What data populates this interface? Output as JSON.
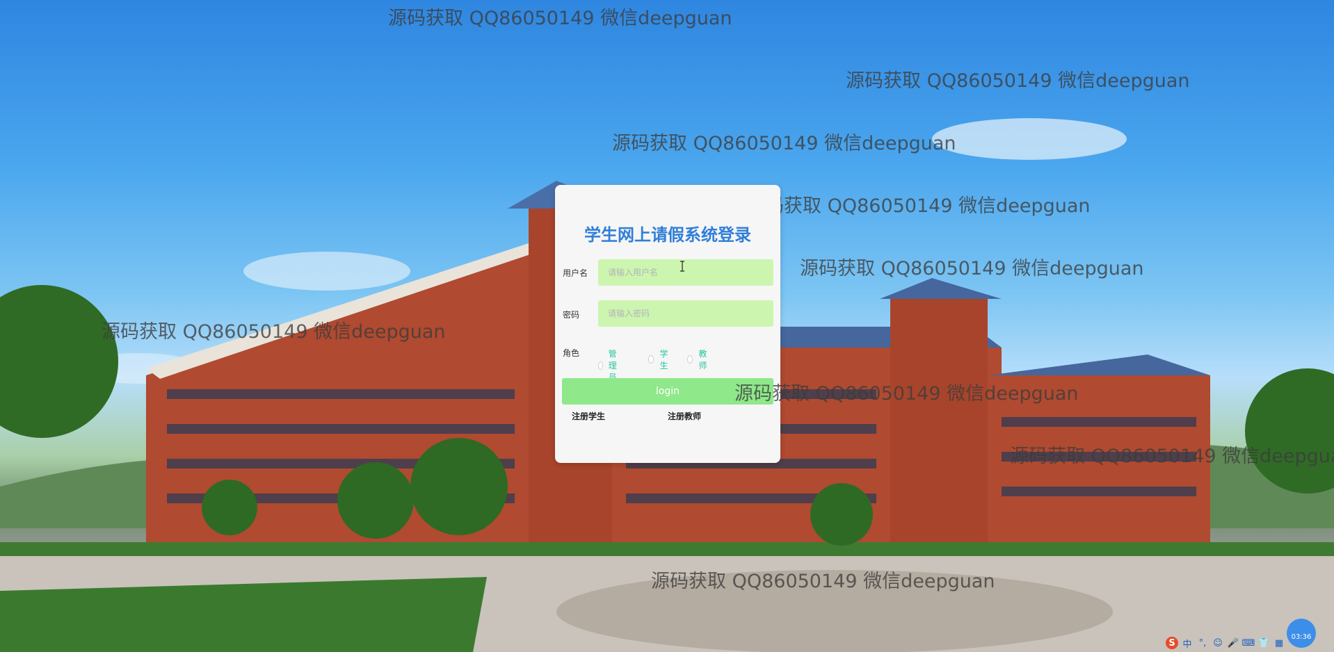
{
  "watermark_text": "源码获取 QQ86050149 微信deepguan",
  "login": {
    "title": "学生网上请假系统登录",
    "username_label": "用户名",
    "username_placeholder": "请输入用户名",
    "password_label": "密码",
    "password_placeholder": "请输入密码",
    "role_label": "角色",
    "roles": [
      "管理员",
      "学生",
      "教师"
    ],
    "login_button": "login",
    "register_student": "注册学生",
    "register_teacher": "注册教师"
  },
  "colors": {
    "title": "#2f7fd8",
    "input_bg": "#ccf5b0",
    "button_bg": "#8fe88a",
    "role_label": "#26c6a0",
    "card_bg": "#f6f6f6"
  },
  "taskbar": {
    "icons": [
      "sogou-input-icon",
      "chinese-mode-icon",
      "punctuation-icon",
      "emoji-icon",
      "microphone-icon",
      "keyboard-icon",
      "skin-icon",
      "toolbox-icon"
    ],
    "labels": [
      "S",
      "中",
      "°,",
      "☺",
      "🎤",
      "⌨",
      "👕",
      "▦"
    ],
    "clock": "03:36"
  }
}
